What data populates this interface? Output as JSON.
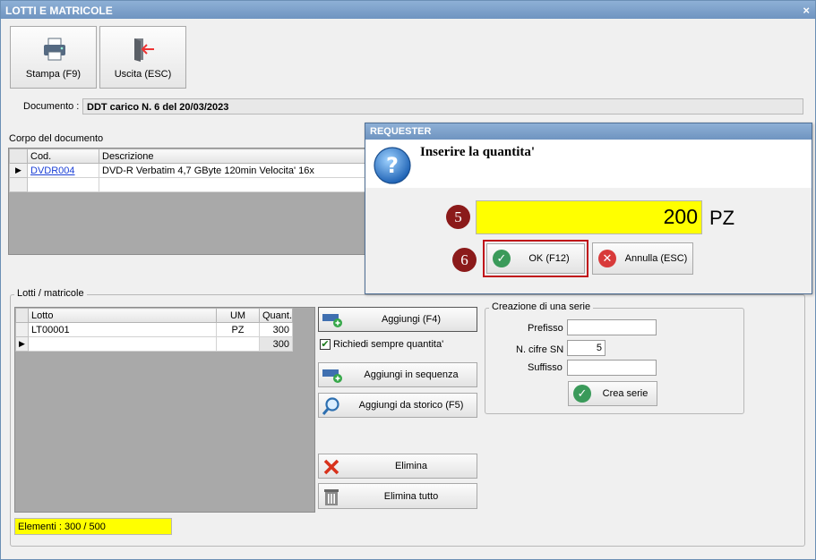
{
  "window": {
    "title": "LOTTI E MATRICOLE",
    "close_glyph": "×"
  },
  "toolbar": {
    "print_label": "Stampa (F9)",
    "exit_label": "Uscita (ESC)"
  },
  "document": {
    "label": "Documento :",
    "value": "DDT carico N. 6 del 20/03/2023"
  },
  "body_section": {
    "label": "Corpo del documento",
    "columns": [
      "Cod.",
      "Descrizione"
    ],
    "rows": [
      {
        "code": "DVDR004",
        "description": "DVD-R Verbatim 4,7 GByte 120min  Velocita' 16x"
      }
    ]
  },
  "lots_section": {
    "label": "Lotti / matricole",
    "columns": [
      "Lotto",
      "UM",
      "Quant."
    ],
    "rows": [
      {
        "lot": "LT00001",
        "um": "PZ",
        "qty": "300"
      }
    ],
    "total_qty": "300",
    "elements_label": "Elementi : 300 / 500"
  },
  "actions": {
    "add": "Aggiungi (F4)",
    "always_ask_qty": "Richiedi sempre quantita'",
    "add_sequence": "Aggiungi in sequenza",
    "add_history": "Aggiungi da storico (F5)",
    "delete": "Elimina",
    "delete_all": "Elimina tutto"
  },
  "series": {
    "label": "Creazione di una serie",
    "prefix_label": "Prefisso",
    "digits_label": "N. cifre SN",
    "digits_value": "5",
    "suffix_label": "Suffisso",
    "create_button": "Crea serie"
  },
  "requester": {
    "title": "REQUESTER",
    "message": "Inserire la quantita'",
    "quantity_value": "200",
    "unit": "PZ",
    "ok_label": "OK (F12)",
    "cancel_label": "Annulla (ESC)",
    "step_badge_input": "5",
    "step_badge_ok": "6"
  },
  "colors": {
    "titlebar": "#7a9dc8",
    "highlight_yellow": "#ffff00",
    "badge": "#8b1a1a",
    "ok_green": "#3a9a5a",
    "cancel_red": "#d83a3a",
    "ok_frame": "#c0101a"
  }
}
